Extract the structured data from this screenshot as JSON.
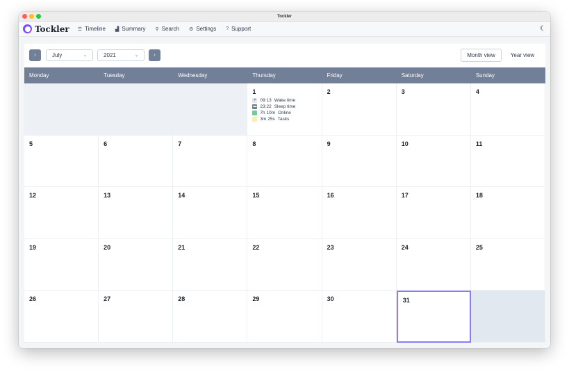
{
  "window": {
    "title": "Tockler"
  },
  "brand": {
    "name": "Tockler"
  },
  "nav": {
    "items": [
      {
        "label": "Timeline",
        "icon": "timeline-icon",
        "glyph": "☰"
      },
      {
        "label": "Summary",
        "icon": "chart-icon",
        "glyph": "▟"
      },
      {
        "label": "Search",
        "icon": "search-icon",
        "glyph": "⚲"
      },
      {
        "label": "Settings",
        "icon": "gear-icon",
        "glyph": "⚙"
      },
      {
        "label": "Support",
        "icon": "help-icon",
        "glyph": "?"
      }
    ],
    "theme_icon": "moon-icon"
  },
  "toolbar": {
    "prev_glyph": "‹",
    "next_glyph": "›",
    "month": "July",
    "year": "2021",
    "month_view_label": "Month view",
    "year_view_label": "Year view"
  },
  "calendar": {
    "weekdays": [
      "Monday",
      "Tuesday",
      "Wednesday",
      "Thursday",
      "Friday",
      "Saturday",
      "Sunday"
    ],
    "days": {
      "d1": "1",
      "d2": "2",
      "d3": "3",
      "d4": "4",
      "d5": "5",
      "d6": "6",
      "d7": "7",
      "d8": "8",
      "d9": "9",
      "d10": "10",
      "d11": "11",
      "d12": "12",
      "d13": "13",
      "d14": "14",
      "d15": "15",
      "d16": "16",
      "d17": "17",
      "d18": "18",
      "d19": "19",
      "d20": "20",
      "d21": "21",
      "d22": "22",
      "d23": "23",
      "d24": "24",
      "d25": "25",
      "d26": "26",
      "d27": "27",
      "d28": "28",
      "d29": "29",
      "d30": "30",
      "d31": "31"
    },
    "day1_events": [
      {
        "value": "09:13",
        "label": "Wake time",
        "icon": "sun-icon"
      },
      {
        "value": "23:22",
        "label": "Sleep time",
        "icon": "bed-icon"
      },
      {
        "value": "7h 10m",
        "label": "Online",
        "color": "#68d391"
      },
      {
        "value": "3m 25s",
        "label": "Tasks",
        "color": "#fdf0a0"
      }
    ],
    "selected_day": "31"
  },
  "colors": {
    "accent": "#7c4dff",
    "header_bg": "#718096",
    "today_border": "#8b7cf6"
  }
}
